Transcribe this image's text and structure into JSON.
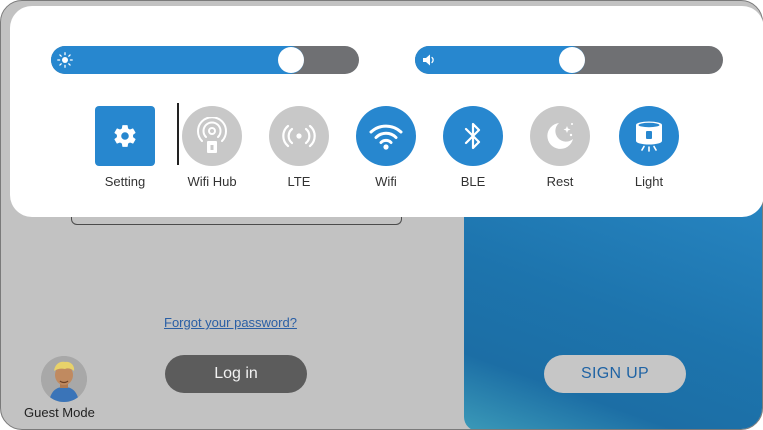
{
  "colors": {
    "accent": "#2787cf",
    "inactive": "#c8c8c8",
    "track": "#6f7073"
  },
  "sliders": {
    "brightness": {
      "icon": "sun-icon",
      "level": 0.78
    },
    "volume": {
      "icon": "speaker-icon",
      "level": 0.51
    }
  },
  "tiles": [
    {
      "label": "Setting",
      "icon": "gear-icon",
      "active": true
    },
    {
      "label": "Wifi Hub",
      "icon": "wifi-hub-icon",
      "active": false
    },
    {
      "label": "LTE",
      "icon": "lte-icon",
      "active": false
    },
    {
      "label": "Wifi",
      "icon": "wifi-icon",
      "active": true
    },
    {
      "label": "BLE",
      "icon": "bluetooth-icon",
      "active": true
    },
    {
      "label": "Rest",
      "icon": "moon-icon",
      "active": false
    },
    {
      "label": "Light",
      "icon": "light-icon",
      "active": true
    }
  ],
  "login": {
    "forgot_label": "Forgot your password?",
    "login_label": "Log in",
    "signup_label": "SIGN UP",
    "guest_label": "Guest Mode"
  }
}
